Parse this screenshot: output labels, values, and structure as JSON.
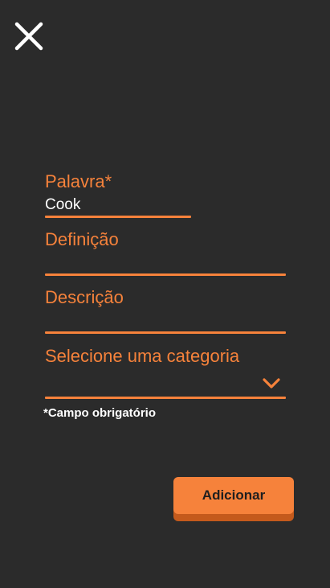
{
  "header": {
    "close_icon": "close-icon"
  },
  "form": {
    "word": {
      "label": "Palavra*",
      "value": "Cook"
    },
    "definition": {
      "label": "Definição",
      "value": ""
    },
    "description": {
      "label": "Descrição",
      "value": ""
    },
    "category": {
      "placeholder": "Selecione uma categoria",
      "icon": "chevron-down-icon"
    },
    "required_note": "*Campo obrigatório"
  },
  "actions": {
    "add_label": "Adicionar"
  },
  "colors": {
    "background": "#2b2b2b",
    "accent": "#f6823b",
    "accent_dark": "#c45a1c",
    "text_light": "#ffffff"
  }
}
